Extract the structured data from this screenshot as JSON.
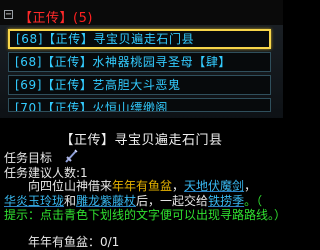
{
  "category": {
    "toggle": "−",
    "name": "【正传】",
    "count": "(5)"
  },
  "quests": [
    {
      "label": "[68]【正传】寻宝贝遍走石门县"
    },
    {
      "label": "[68]【正传】水神器桃园寻圣母【肆】"
    },
    {
      "label": "[69]【正传】艺高胆大斗恶鬼"
    },
    {
      "label": "[70]【正传】火恒山缥缈阁"
    }
  ],
  "detail": {
    "title": "【正传】寻宝贝遍走石门县",
    "goal_label": "任务目标",
    "players_label": "任务建议人数:1",
    "desc_prefix": "向四位山神借来",
    "item1": "年年有鱼盆",
    "sep1": "，",
    "item2": "天地伏魔剑",
    "sep2": "，",
    "item3": "华炎玉玲珑",
    "and": "和",
    "item4": "雕龙紫藤杖",
    "desc_mid": "后，一起交给",
    "npc": "铁捞季",
    "desc_end": "。（",
    "hint": "提示：点击青色下划线的文字便可以出现寻路路线。）",
    "progress": "年年有鱼盆：0/1"
  },
  "colors": {
    "quest_text": "#33ccff",
    "selected_border": "#f7d64a",
    "category_red": "#ff2020",
    "item_yellow": "#e6b300",
    "link_cyan": "#38b8f0",
    "hint_green": "#30e030"
  }
}
